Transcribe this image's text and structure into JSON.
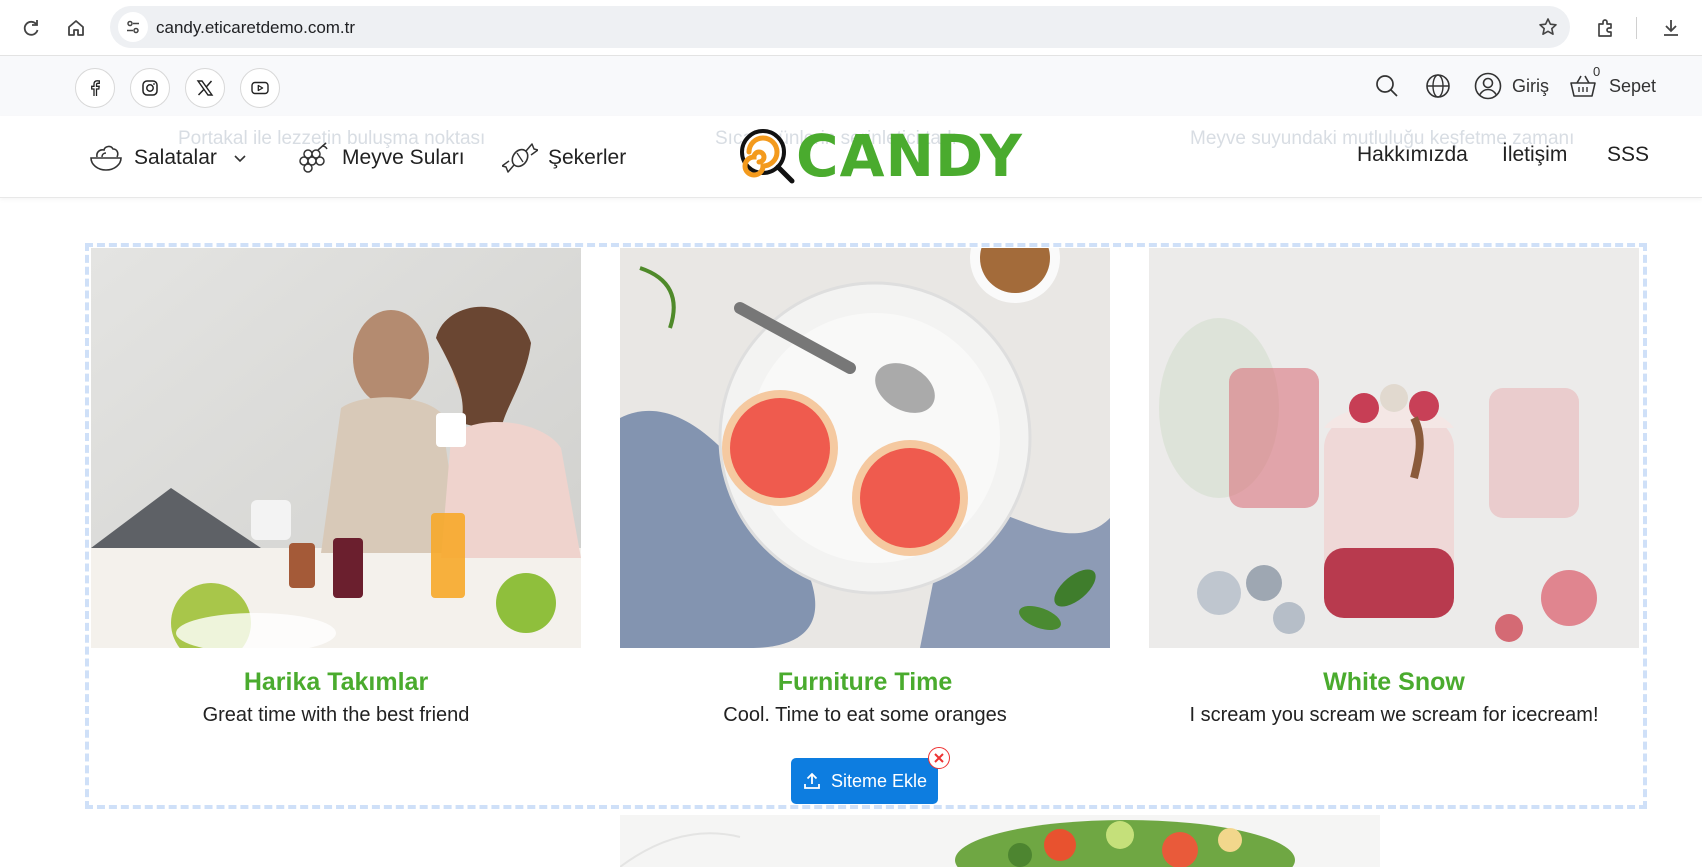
{
  "browser": {
    "url": "candy.eticaretdemo.com.tr"
  },
  "topbar": {
    "social": [
      "facebook-icon",
      "instagram-icon",
      "x-icon",
      "youtube-icon"
    ],
    "login_label": "Giriş",
    "cart_label": "Sepet",
    "cart_count": "0"
  },
  "nav": {
    "left": [
      {
        "label": "Salatalar"
      },
      {
        "label": "Meyve Suları"
      },
      {
        "label": "Şekerler"
      }
    ],
    "logo_text": "CANDY",
    "right": [
      {
        "label": "Hakkımızda"
      },
      {
        "label": "İletişim"
      },
      {
        "label": "SSS"
      }
    ],
    "ghost_texts": [
      "Portakal ile lezzetin buluşma noktası",
      "Sıcak günlerin serinletici tadı",
      "Meyve suyundaki mutluluğu keşfetme zamanı"
    ]
  },
  "cards": [
    {
      "title": "Harika Takımlar",
      "subtitle": "Great time with the best friend"
    },
    {
      "title": "Furniture Time",
      "subtitle": "Cool. Time to eat some oranges"
    },
    {
      "title": "White Snow",
      "subtitle": "I scream you scream we scream for icecream!"
    }
  ],
  "add_button": {
    "label": "Siteme Ekle"
  },
  "colors": {
    "brand": "#4aab2e",
    "button": "#0d7de0",
    "frame": "#cfe0f8"
  }
}
